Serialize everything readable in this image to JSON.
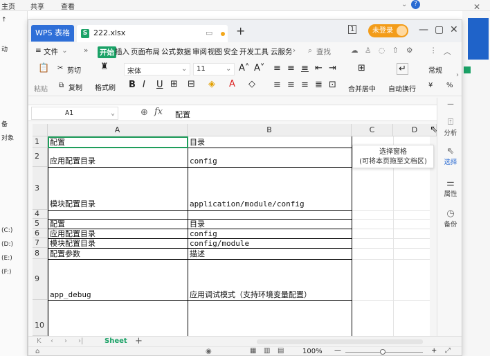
{
  "background": {
    "menu": [
      "主页",
      "共享",
      "查看"
    ],
    "left_items": [
      "动",
      "备",
      "对象",
      "(C:)",
      "(D:)",
      "(E:)",
      "(F:)"
    ]
  },
  "titlebar": {
    "app_tab": "WPS 表格",
    "file_tab": "222.xlsx",
    "file_icon_letter": "S",
    "login": "未登录",
    "page_badge": "1"
  },
  "menu": [
    "文件",
    "»",
    "开始",
    "插入",
    "页面布局",
    "公式",
    "数据",
    "审阅",
    "视图",
    "安全",
    "开发工具",
    "云服务"
  ],
  "menu_search": "查找",
  "ribbon": {
    "paste": "粘贴",
    "cut": "剪切",
    "copy": "复制",
    "format_painter": "格式刷",
    "font": "宋体",
    "size": "11",
    "merge": "合并居中",
    "wrap": "自动换行",
    "number_format": "常规",
    "currency": "¥",
    "percent": "%"
  },
  "formula_bar": {
    "cell_ref": "A1",
    "fx": "fx",
    "value": "配置"
  },
  "columns": [
    "A",
    "B",
    "C",
    "D"
  ],
  "rows": [
    {
      "num": "1",
      "a": "配置",
      "b": "目录"
    },
    {
      "num": "2",
      "a": "应用配置目录",
      "b": "config"
    },
    {
      "num": "3",
      "a": "模块配置目录",
      "b": "application/module/config"
    },
    {
      "num": "4",
      "a": "",
      "b": ""
    },
    {
      "num": "5",
      "a": "配置",
      "b": "目录"
    },
    {
      "num": "6",
      "a": "应用配置目录",
      "b": "config"
    },
    {
      "num": "7",
      "a": "模块配置目录",
      "b": "config/module"
    },
    {
      "num": "8",
      "a": "配置参数",
      "b": "描述"
    },
    {
      "num": "9",
      "a": "app_debug",
      "b": "应用调试模式（支持环境变量配置）"
    },
    {
      "num": "10",
      "a": "",
      "b": ""
    }
  ],
  "sidebar": [
    "分析",
    "选择",
    "属性",
    "备份"
  ],
  "tooltip": {
    "line1": "选择窗格",
    "line2": "(可将本页拖至文档区)"
  },
  "sheet_tab": "Sheet",
  "status": {
    "zoom": "100%"
  }
}
